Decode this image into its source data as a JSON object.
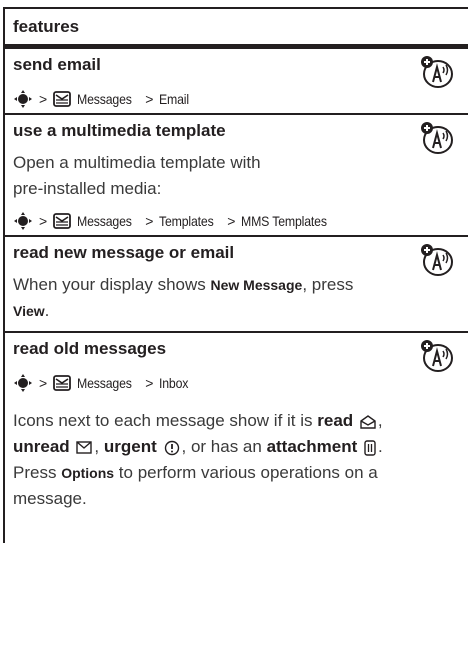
{
  "header": {
    "title": "features"
  },
  "sections": [
    {
      "title": "send email",
      "path": [
        "Messages",
        "Email"
      ]
    },
    {
      "title": "use a multimedia template",
      "body_line1": "Open a multimedia template with",
      "body_line2": "pre-installed media:",
      "path": [
        "Messages",
        "Templates",
        "MMS Templates"
      ]
    },
    {
      "title": "read new message or email",
      "body_pre": "When your display shows ",
      "body_key1": "New Message",
      "body_mid": ", press",
      "body_key2": "View",
      "body_end": "."
    },
    {
      "title": "read old messages",
      "path": [
        "Messages",
        "Inbox"
      ],
      "p1": "Icons next to each message show if it is ",
      "read": "read",
      "unread": "unread",
      "urgent": "urgent",
      "or_has_an": ", or has an ",
      "attachment": "attachment",
      "p3_pre": "Press ",
      "options": "Options",
      "p3_post": " to perform various operations on a",
      "p4": "message."
    }
  ],
  "separator": ">",
  "icons": {
    "nav": "navigation-key-icon",
    "messages": "messages-icon",
    "network": "network-dependent-feature-icon",
    "read": "read-message-icon",
    "unread": "unread-message-icon",
    "urgent": "urgent-icon",
    "attachment": "attachment-icon"
  }
}
